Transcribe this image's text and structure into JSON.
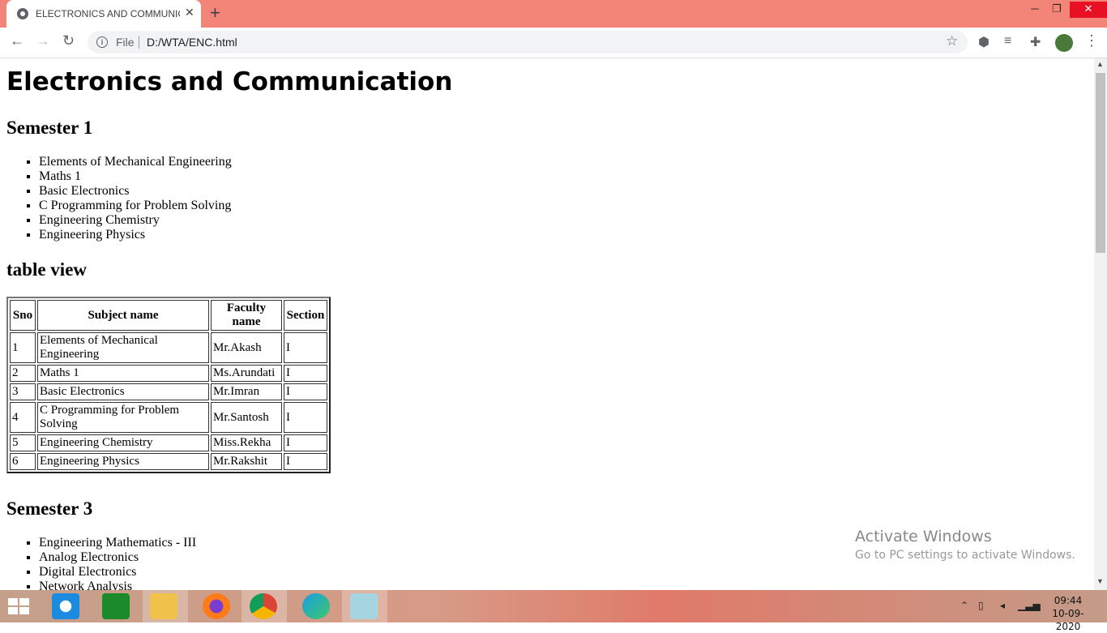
{
  "browser": {
    "tab_title": "ELECTRONICS AND COMMUNICATION",
    "tab_close": "✕",
    "new_tab": "+",
    "file_label": "File",
    "url": "D:/WTA/ENC.html"
  },
  "page": {
    "title": "Electronics and Communication",
    "semester1": {
      "heading": "Semester 1",
      "subjects": [
        "Elements of Mechanical Engineering",
        "Maths 1",
        "Basic Electronics",
        "C Programming for Problem Solving",
        "Engineering Chemistry",
        "Engineering Physics"
      ]
    },
    "table_view": {
      "heading": "table view",
      "columns": [
        "Sno",
        "Subject name",
        "Faculty name",
        "Section"
      ],
      "rows": [
        [
          "1",
          "Elements of Mechanical Engineering",
          "Mr.Akash",
          "I"
        ],
        [
          "2",
          "Maths 1",
          "Ms.Arundati",
          "I"
        ],
        [
          "3",
          "Basic Electronics",
          "Mr.Imran",
          "I"
        ],
        [
          "4",
          "C Programming for Problem Solving",
          "Mr.Santosh",
          "I"
        ],
        [
          "5",
          "Engineering Chemistry",
          "Miss.Rekha",
          "I"
        ],
        [
          "6",
          "Engineering Physics",
          "Mr.Rakshit",
          "I"
        ]
      ]
    },
    "semester3": {
      "heading": "Semester 3",
      "subjects": [
        "Engineering Mathematics - III",
        "Analog Electronics",
        "Digital Electronics",
        "Network Analysis"
      ]
    }
  },
  "watermark": {
    "title": "Activate Windows",
    "subtitle": "Go to PC settings to activate Windows."
  },
  "taskbar": {
    "apps": [
      "internet-explorer-icon",
      "store-icon",
      "file-explorer-icon",
      "firefox-icon",
      "chrome-icon",
      "edge-icon",
      "notepad-icon"
    ],
    "time": "09:44",
    "date": "10-09-2020"
  }
}
